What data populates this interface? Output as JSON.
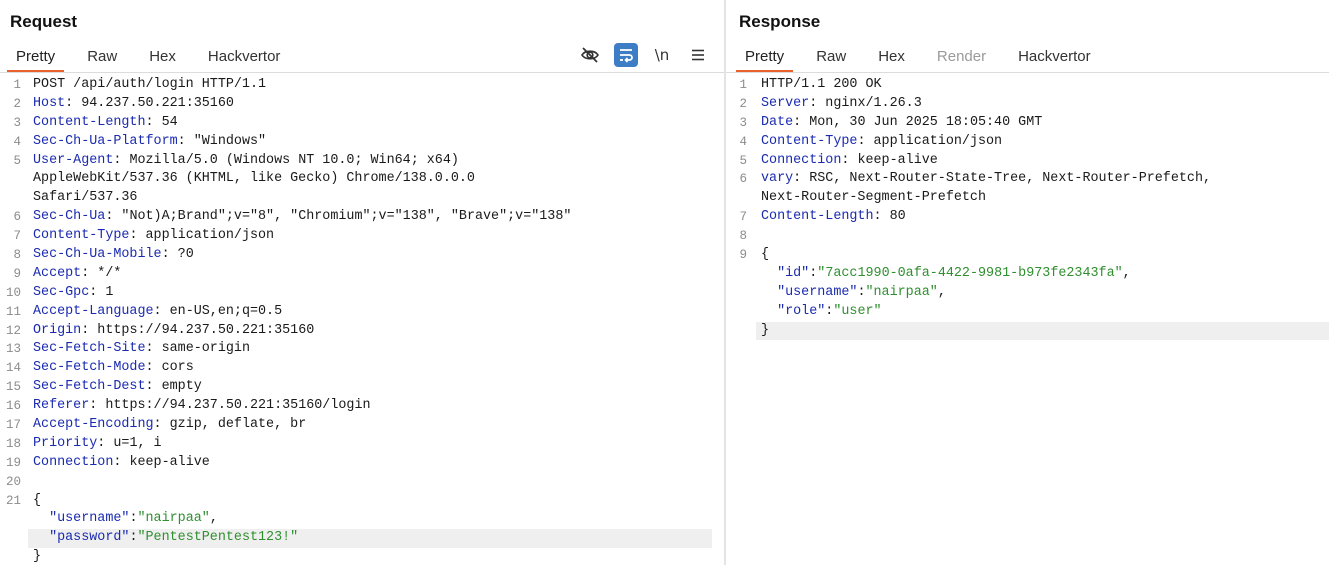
{
  "request": {
    "title": "Request",
    "tabs": [
      "Pretty",
      "Raw",
      "Hex",
      "Hackvertor"
    ],
    "toolbar": {
      "newline_label": "\\n"
    },
    "headers": [
      {
        "n": "1",
        "text": "POST /api/auth/login HTTP/1.1"
      },
      {
        "n": "2",
        "key": "Host",
        "value": " 94.237.50.221:35160"
      },
      {
        "n": "3",
        "key": "Content-Length",
        "value": " 54"
      },
      {
        "n": "4",
        "key": "Sec-Ch-Ua-Platform",
        "value": " \"Windows\""
      },
      {
        "n": "5",
        "key": "User-Agent",
        "value": " Mozilla/5.0 (Windows NT 10.0; Win64; x64)"
      },
      {
        "n": "",
        "text": "AppleWebKit/537.36 (KHTML, like Gecko) Chrome/138.0.0.0"
      },
      {
        "n": "",
        "text": "Safari/537.36"
      },
      {
        "n": "6",
        "key": "Sec-Ch-Ua",
        "value": " \"Not)A;Brand\";v=\"8\", \"Chromium\";v=\"138\", \"Brave\";v=\"138\""
      },
      {
        "n": "7",
        "key": "Content-Type",
        "value": " application/json"
      },
      {
        "n": "8",
        "key": "Sec-Ch-Ua-Mobile",
        "value": " ?0"
      },
      {
        "n": "9",
        "key": "Accept",
        "value": " */*"
      },
      {
        "n": "10",
        "key": "Sec-Gpc",
        "value": " 1"
      },
      {
        "n": "11",
        "key": "Accept-Language",
        "value": " en-US,en;q=0.5"
      },
      {
        "n": "12",
        "key": "Origin",
        "value": " https://94.237.50.221:35160"
      },
      {
        "n": "13",
        "key": "Sec-Fetch-Site",
        "value": " same-origin"
      },
      {
        "n": "14",
        "key": "Sec-Fetch-Mode",
        "value": " cors"
      },
      {
        "n": "15",
        "key": "Sec-Fetch-Dest",
        "value": " empty"
      },
      {
        "n": "16",
        "key": "Referer",
        "value": " https://94.237.50.221:35160/login"
      },
      {
        "n": "17",
        "key": "Accept-Encoding",
        "value": " gzip, deflate, br"
      },
      {
        "n": "18",
        "key": "Priority",
        "value": " u=1, i"
      },
      {
        "n": "19",
        "key": "Connection",
        "value": " keep-alive"
      },
      {
        "n": "20",
        "text": ""
      },
      {
        "n": "21",
        "text": "{"
      }
    ],
    "body": {
      "username_key": "\"username\"",
      "username_value": "\"nairpaa\"",
      "password_key": "\"password\"",
      "password_value": "\"PentestPentest123!\"",
      "close": "}"
    }
  },
  "response": {
    "title": "Response",
    "tabs": [
      "Pretty",
      "Raw",
      "Hex",
      "Render",
      "Hackvertor"
    ],
    "headers": [
      {
        "n": "1",
        "text": "HTTP/1.1 200 OK"
      },
      {
        "n": "2",
        "key": "Server",
        "value": " nginx/1.26.3"
      },
      {
        "n": "3",
        "key": "Date",
        "value": " Mon, 30 Jun 2025 18:05:40 GMT"
      },
      {
        "n": "4",
        "key": "Content-Type",
        "value": " application/json"
      },
      {
        "n": "5",
        "key": "Connection",
        "value": " keep-alive"
      },
      {
        "n": "6",
        "key": "vary",
        "value": " RSC, Next-Router-State-Tree, Next-Router-Prefetch,"
      },
      {
        "n": "",
        "text": "Next-Router-Segment-Prefetch"
      },
      {
        "n": "7",
        "key": "Content-Length",
        "value": " 80"
      },
      {
        "n": "8",
        "text": ""
      },
      {
        "n": "9",
        "text": "{"
      }
    ],
    "body": {
      "id_key": "\"id\"",
      "id_value": "\"7acc1990-0afa-4422-9981-b973fe2343fa\"",
      "username_key": "\"username\"",
      "username_value": "\"nairpaa\"",
      "role_key": "\"role\"",
      "role_value": "\"user\"",
      "close": "}"
    }
  },
  "icons": {
    "hide": "eye-off-icon",
    "wrap": "word-wrap-icon",
    "menu": "menu-icon"
  },
  "colors": {
    "accent_tab": "#e8612c",
    "header_key": "#1b2bb0",
    "json_string": "#2f8f2f",
    "toggle_active": "#3d7dc6"
  }
}
